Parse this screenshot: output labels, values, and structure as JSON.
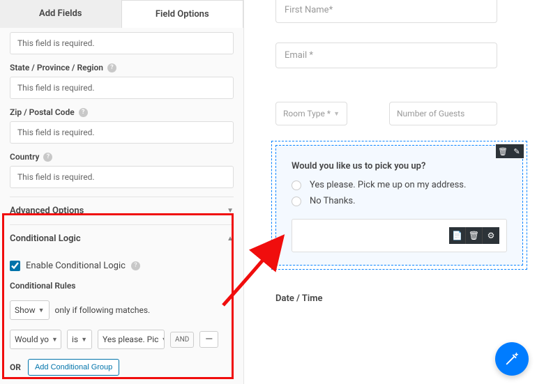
{
  "tabs": {
    "add_fields": "Add Fields",
    "field_options": "Field Options"
  },
  "left": {
    "truncated_top": "This field is required.",
    "state_label": "State / Province / Region",
    "state_value": "This field is required.",
    "zip_label": "Zip / Postal Code",
    "zip_value": "This field is required.",
    "country_label": "Country",
    "country_value": "This field is required."
  },
  "sections": {
    "advanced": "Advanced Options",
    "conditional": "Conditional Logic"
  },
  "cond": {
    "enable_label": "Enable Conditional Logic",
    "rules_label": "Conditional Rules",
    "show": "Show",
    "matches": "only if following matches.",
    "field": "Would yo",
    "op": "is",
    "value": "Yes please. Pic",
    "and": "AND",
    "or": "OR",
    "add_group": "Add Conditional Group",
    "minus": "—"
  },
  "preview": {
    "first_name": "First Name*",
    "email": "Email *",
    "room_type": "Room Type *",
    "guests": "Number of Guests",
    "question": "Would you like us to pick you up?",
    "opt1": "Yes please. Pick me up on my address.",
    "opt2": "No Thanks.",
    "datetime": "Date / Time"
  },
  "icons": {
    "help": "?",
    "trash": "🗑",
    "pencil": "✎",
    "copy": "📄",
    "gear": "⚙",
    "wand": "✨",
    "caret_down": "▼",
    "caret_up": "▲"
  }
}
